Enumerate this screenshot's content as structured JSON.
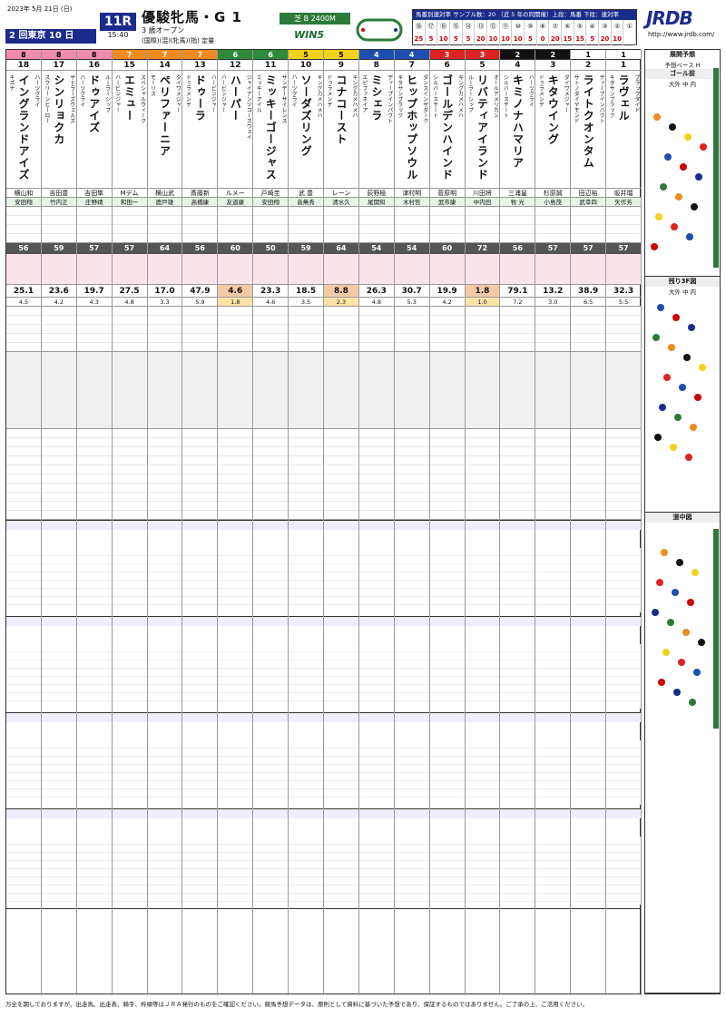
{
  "header": {
    "date": "2023年 5月 21日 (日)",
    "venue": "2 回東京 10 日",
    "race_no": "11R",
    "post_time": "15:40",
    "title": "優駿牝馬・G 1",
    "cond": "3 歳オープン",
    "cond2": "(国際)(混)(牝馬)(指) 定量",
    "course": "芝 B 2400M",
    "win5": "WIN5",
    "stat_title": "馬番別連対率 サンプル数：20 （近 5 年の同開催）上段：馬番 下段：連対率",
    "stat_top": [
      "⑱",
      "⑰",
      "⑯",
      "⑮",
      "⑭",
      "⑬",
      "⑫",
      "⑪",
      "⑩",
      "⑨",
      "⑧",
      "⑦",
      "⑥",
      "⑤",
      "④",
      "③",
      "②",
      "①"
    ],
    "stat_bottom": [
      "25",
      "5",
      "10",
      "5",
      "5",
      "20",
      "10",
      "10",
      "10",
      "5",
      "0",
      "20",
      "15",
      "15",
      "5",
      "20",
      "10",
      ""
    ],
    "brand": "JRDB",
    "url": "http://www.jrdb.com/"
  },
  "horses": [
    {
      "waku": "8",
      "num": "18",
      "sire": "キズナ",
      "name": "イングランドアイズ",
      "dam": "ハーツクライ",
      "jockey": "横山和",
      "trainer": "安田翔",
      "odds": "25.1",
      "ninki": "4.5",
      "idx": "56"
    },
    {
      "waku": "8",
      "num": "17",
      "sire": "スクリーンヒーロー",
      "name": "シンリョクカ",
      "dam": "サドラーズウェルズ",
      "jockey": "吉田豊",
      "trainer": "竹内正",
      "odds": "23.6",
      "ninki": "4.2",
      "idx": "59"
    },
    {
      "waku": "8",
      "num": "16",
      "sire": "ハーツクライ",
      "name": "ドゥアイズ",
      "dam": "ルーラーシップ",
      "jockey": "吉田隼",
      "trainer": "庄野靖",
      "odds": "19.7",
      "ninki": "4.3",
      "idx": "57"
    },
    {
      "waku": "7",
      "num": "15",
      "sire": "ハービンジャー",
      "name": "エミュー",
      "dam": "スペシャルウィーク",
      "jockey": "Mデム",
      "trainer": "和田一",
      "odds": "27.5",
      "ninki": "4.8",
      "idx": "57"
    },
    {
      "waku": "7",
      "num": "14",
      "sire": "モーリス",
      "name": "ペリファーニア",
      "dam": "ダイワメジャー",
      "jockey": "横山武",
      "trainer": "鹿戸雄",
      "odds": "17.0",
      "ninki": "3.3",
      "idx": "64"
    },
    {
      "waku": "7",
      "num": "13",
      "sire": "ドゥラメンテ",
      "name": "ドゥーラ",
      "dam": "ハービンジャー",
      "jockey": "斎藤新",
      "trainer": "高橋康",
      "odds": "47.9",
      "ninki": "5.9",
      "idx": "56"
    },
    {
      "waku": "6",
      "num": "12",
      "sire": "ハービンジャー",
      "name": "ハーパー",
      "dam": "ジャイアンツコーズウェイ",
      "jockey": "ルメー",
      "trainer": "友道康",
      "odds": "4.6",
      "ninki": "1.8",
      "idx": "60"
    },
    {
      "waku": "6",
      "num": "11",
      "sire": "ミッキーアイル",
      "name": "ミッキーゴージャス",
      "dam": "サンデーサイレンス",
      "jockey": "戸崎圭",
      "trainer": "安田翔",
      "odds": "23.3",
      "ninki": "4.6",
      "idx": "50"
    },
    {
      "waku": "5",
      "num": "10",
      "sire": "ハーツクライ",
      "name": "ソーダズリング",
      "dam": "キングカメハメハ",
      "jockey": "武 豊",
      "trainer": "音無秀",
      "odds": "18.5",
      "ninki": "3.5",
      "idx": "59"
    },
    {
      "waku": "5",
      "num": "9",
      "sire": "ドゥラメンテ",
      "name": "コナコースト",
      "dam": "キングカメハメハ",
      "jockey": "レーン",
      "trainer": "清水久",
      "odds": "8.8",
      "ninki": "2.3",
      "idx": "64"
    },
    {
      "waku": "4",
      "num": "8",
      "sire": "エピファネイア",
      "name": "ミシェラ",
      "dam": "ディープインパクト",
      "jockey": "荻野極",
      "trainer": "尾関知",
      "odds": "26.3",
      "ninki": "4.8",
      "idx": "54"
    },
    {
      "waku": "4",
      "num": "7",
      "sire": "キタサンブラック",
      "name": "ヒップホップソウル",
      "dam": "ダンスインザダーク",
      "jockey": "津村明",
      "trainer": "木村哲",
      "odds": "30.7",
      "ninki": "5.3",
      "idx": "54"
    },
    {
      "waku": "3",
      "num": "6",
      "sire": "シルバーステート",
      "name": "ゴールデンハインド",
      "dam": "キングカメハメハ",
      "jockey": "菅原明",
      "trainer": "武市康",
      "odds": "19.9",
      "ninki": "4.2",
      "idx": "60"
    },
    {
      "waku": "3",
      "num": "5",
      "sire": "ルーラーシップ",
      "name": "リバティアイランド",
      "dam": "オールアメリカン",
      "jockey": "川田将",
      "trainer": "中内田",
      "odds": "1.8",
      "ninki": "1.0",
      "idx": "72"
    },
    {
      "waku": "2",
      "num": "4",
      "sire": "シルバーステート",
      "name": "キミノナハマリア",
      "dam": "ハーツクライ",
      "jockey": "三浦皇",
      "trainer": "牧 光",
      "odds": "79.1",
      "ninki": "7.2",
      "idx": "56"
    },
    {
      "waku": "2",
      "num": "3",
      "sire": "ドゥラメンテ",
      "name": "キタウイング",
      "dam": "ダイワメジャー",
      "jockey": "杉原誠",
      "trainer": "小島茂",
      "odds": "13.2",
      "ninki": "3.0",
      "idx": "57"
    },
    {
      "waku": "1",
      "num": "2",
      "sire": "サトノダイヤモンド",
      "name": "ライトクオンタム",
      "dam": "ディープインパクト",
      "jockey": "田辺裕",
      "trainer": "武幸四",
      "odds": "38.9",
      "ninki": "6.5",
      "idx": "57"
    },
    {
      "waku": "1",
      "num": "1",
      "sire": "キタサンブラック",
      "name": "ラヴェル",
      "dam": "ブラックタイド",
      "jockey": "坂井瑠",
      "trainer": "矢作芳",
      "odds": "32.3",
      "ninki": "5.5",
      "idx": "57"
    }
  ],
  "right_panel": {
    "s1_title": "展開予想",
    "s1_sub": "予想ペース H",
    "s2_title": "ゴール前",
    "s2_sub": "大外 中 内",
    "s3_title": "残り3F図",
    "s3_sub": "大外 中 内",
    "s4_title": "道中図"
  },
  "footer": "万全を期しておりますが、出走馬、出走表、騎手、枠順等はＪＲＡ発行のものをご確認ください。競馬予想データは、原則として資料に基づいた予想であり、保証するものではありません。ご了承の上、ご活用ください。"
}
